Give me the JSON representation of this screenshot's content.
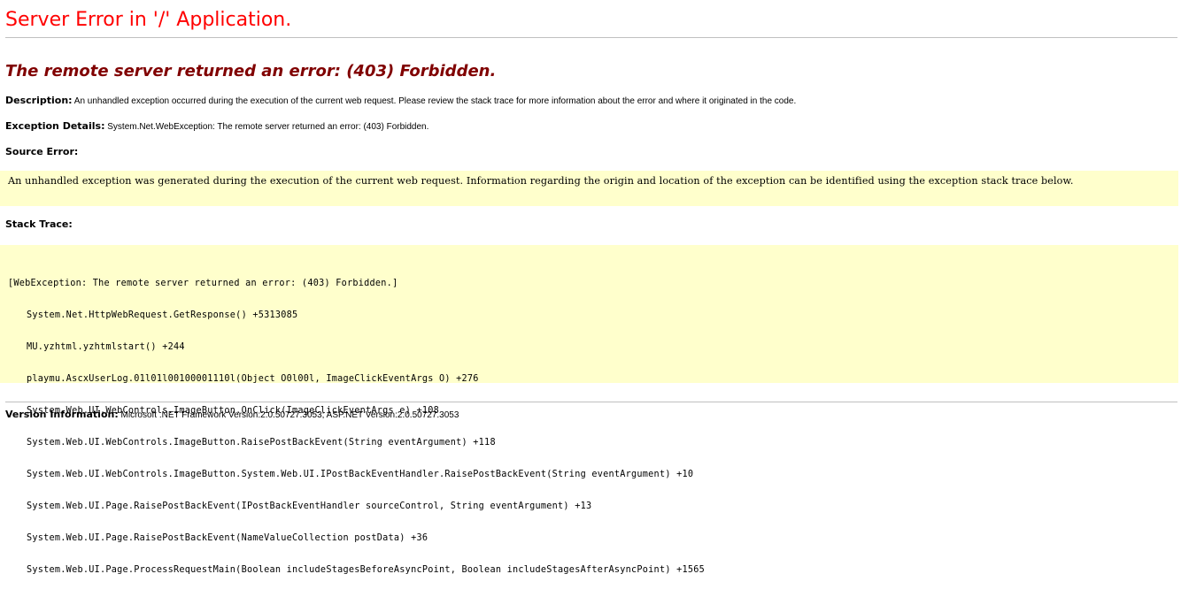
{
  "page": {
    "title": "Server Error in '/' Application.",
    "error_message": "The remote server returned an error: (403) Forbidden."
  },
  "description": {
    "label": "Description:",
    "text": "An unhandled exception occurred during the execution of the current web request. Please review the stack trace for more information about the error and where it originated in the code."
  },
  "exception_details": {
    "label": "Exception Details:",
    "text": "System.Net.WebException: The remote server returned an error: (403) Forbidden."
  },
  "source_error": {
    "label": "Source Error:",
    "text": "An unhandled exception was generated during the execution of the current web request. Information regarding the origin and location of the exception can be identified using the exception stack trace below."
  },
  "stack_trace": {
    "label": "Stack Trace:",
    "header": "[WebException: The remote server returned an error: (403) Forbidden.]",
    "lines": [
      "System.Net.HttpWebRequest.GetResponse() +5313085",
      "MU.yzhtml.yzhtmlstart() +244",
      "playmu.AscxUserLog.01l01l00100001110l(Object O0l00l, ImageClickEventArgs O) +276",
      "System.Web.UI.WebControls.ImageButton.OnClick(ImageClickEventArgs e) +108",
      "System.Web.UI.WebControls.ImageButton.RaisePostBackEvent(String eventArgument) +118",
      "System.Web.UI.WebControls.ImageButton.System.Web.UI.IPostBackEventHandler.RaisePostBackEvent(String eventArgument) +10",
      "System.Web.UI.Page.RaisePostBackEvent(IPostBackEventHandler sourceControl, String eventArgument) +13",
      "System.Web.UI.Page.RaisePostBackEvent(NameValueCollection postData) +36",
      "System.Web.UI.Page.ProcessRequestMain(Boolean includeStagesBeforeAsyncPoint, Boolean includeStagesAfterAsyncPoint) +1565"
    ]
  },
  "version_info": {
    "label": "Version Information:",
    "text": "Microsoft .NET Framework Version:2.0.50727.3053; ASP.NET Version:2.0.50727.3053"
  },
  "colors": {
    "title": "#ff0000",
    "error_message": "#800000",
    "code_background": "#ffffcc",
    "rule": "#c0c0c0"
  }
}
